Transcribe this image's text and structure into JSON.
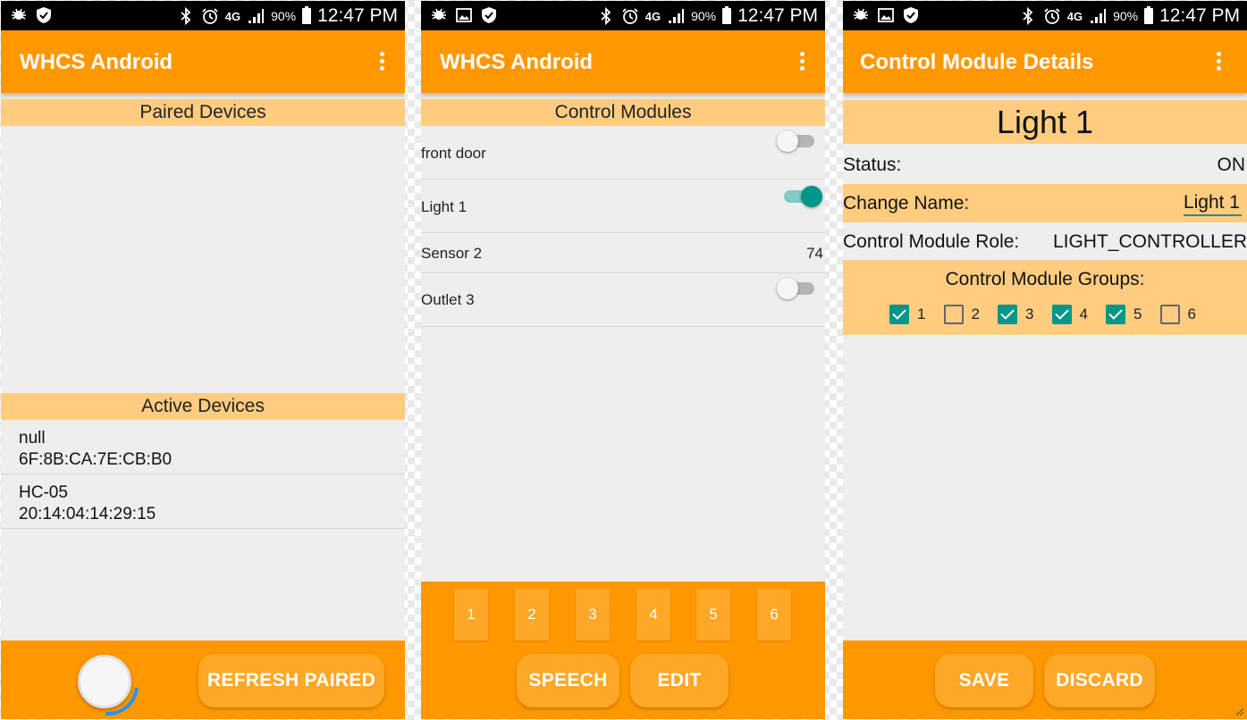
{
  "status_bar": {
    "battery": "90%",
    "network": "4G",
    "time": "12:47 PM"
  },
  "panels": [
    {
      "app_title": "WHCS Android",
      "paired_header": "Paired Devices",
      "active_header": "Active Devices",
      "active_devices": [
        {
          "name": "null",
          "address": "6F:8B:CA:7E:CB:B0"
        },
        {
          "name": "HC-05",
          "address": "20:14:04:14:29:15"
        }
      ],
      "refresh_button": "REFRESH PAIRED"
    },
    {
      "app_title": "WHCS Android",
      "header": "Control Modules",
      "modules": [
        {
          "name": "front door",
          "switch": "off"
        },
        {
          "name": "Light 1",
          "switch": "on"
        },
        {
          "name": "Sensor 2",
          "value": "74"
        },
        {
          "name": "Outlet 3",
          "switch": "off"
        }
      ],
      "group_buttons": [
        "1",
        "2",
        "3",
        "4",
        "5",
        "6"
      ],
      "speech_button": "SPEECH",
      "edit_button": "EDIT"
    },
    {
      "app_title": "Control Module Details",
      "module_name": "Light 1",
      "status_label": "Status:",
      "status_value": "ON",
      "change_name_label": "Change Name:",
      "name_input_value": "Light 1",
      "role_label": "Control Module Role:",
      "role_value": "LIGHT_CONTROLLER",
      "groups_label": "Control Module Groups:",
      "groups": [
        {
          "label": "1",
          "checked": true
        },
        {
          "label": "2",
          "checked": false
        },
        {
          "label": "3",
          "checked": true
        },
        {
          "label": "4",
          "checked": true
        },
        {
          "label": "5",
          "checked": true
        },
        {
          "label": "6",
          "checked": false
        }
      ],
      "save_button": "SAVE",
      "discard_button": "DISCARD"
    }
  ],
  "colors": {
    "primary": "#ff9800",
    "header_bg": "#ffcc80",
    "accent": "#009688",
    "background": "#eeeeee"
  }
}
